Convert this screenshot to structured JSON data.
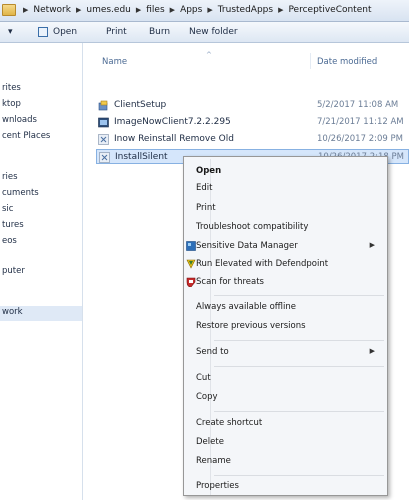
{
  "breadcrumb": [
    "Network",
    "umes.edu",
    "files",
    "Apps",
    "TrustedApps",
    "PerceptiveContent"
  ],
  "toolbar": {
    "organize_label": "▾",
    "open_label": "Open",
    "print_label": "Print",
    "burn_label": "Burn",
    "new_folder_label": "New folder"
  },
  "nav": {
    "items": [
      "rites",
      "ktop",
      "wnloads",
      "cent Places",
      "ries",
      "cuments",
      "sic",
      "tures",
      "eos",
      "puter",
      "work"
    ]
  },
  "columns": {
    "name": "Name",
    "date": "Date modified"
  },
  "files": [
    {
      "name": "ClientSetup",
      "date": "5/2/2017 11:08 AM"
    },
    {
      "name": "ImageNowClient7.2.2.295",
      "date": "7/21/2017 11:12 AM"
    },
    {
      "name": "Inow Reinstall Remove Old",
      "date": "10/26/2017 2:09 PM"
    },
    {
      "name": "InstallSilent",
      "date": "10/26/2017 2:18 PM"
    }
  ],
  "context_menu": {
    "open": "Open",
    "edit": "Edit",
    "print": "Print",
    "troubleshoot": "Troubleshoot compatibility",
    "sensitive": "Sensitive Data Manager",
    "run_elevated": "Run Elevated with Defendpoint",
    "scan": "Scan for threats",
    "offline": "Always available offline",
    "restore": "Restore previous versions",
    "send_to": "Send to",
    "cut": "Cut",
    "copy": "Copy",
    "create_shortcut": "Create shortcut",
    "delete": "Delete",
    "rename": "Rename",
    "properties": "Properties"
  }
}
